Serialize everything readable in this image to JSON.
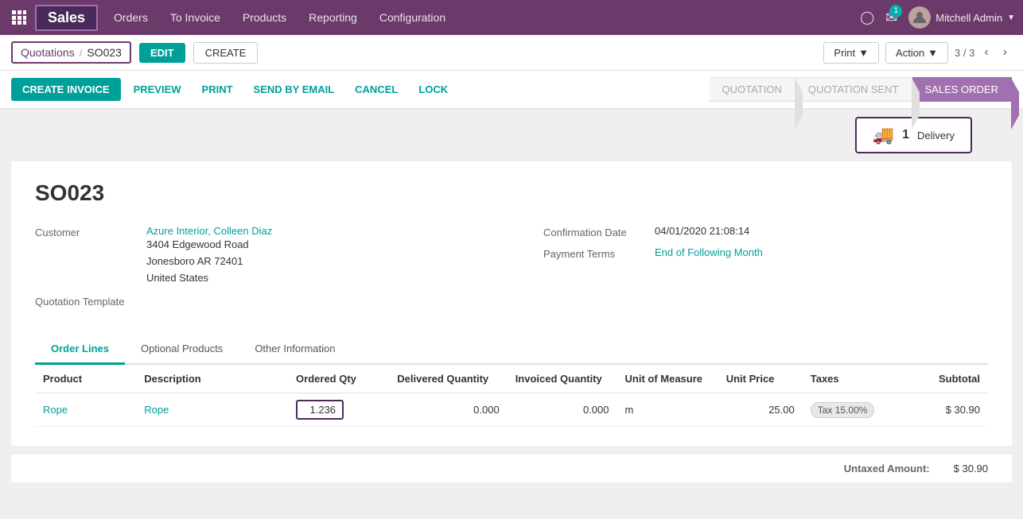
{
  "app": {
    "brand": "Sales"
  },
  "topnav": {
    "links": [
      "Orders",
      "To Invoice",
      "Products",
      "Reporting",
      "Configuration"
    ],
    "chat_badge": "1",
    "user": "Mitchell Admin"
  },
  "breadcrumb": {
    "parent": "Quotations",
    "current": "SO023"
  },
  "actions": {
    "edit_label": "EDIT",
    "create_label": "CREATE",
    "print_label": "Print",
    "action_label": "Action",
    "pagination": "3 / 3"
  },
  "toolbar": {
    "create_invoice_label": "CREATE INVOICE",
    "preview_label": "PREVIEW",
    "print_label": "PRINT",
    "send_email_label": "SEND BY EMAIL",
    "cancel_label": "CANCEL",
    "lock_label": "LOCK"
  },
  "status_bar": {
    "items": [
      "QUOTATION",
      "QUOTATION SENT",
      "SALES ORDER"
    ]
  },
  "delivery": {
    "count": "1",
    "label": "Delivery"
  },
  "form": {
    "so_number": "SO023",
    "customer_label": "Customer",
    "customer_name": "Azure Interior, Colleen Diaz",
    "customer_address": "3404 Edgewood Road\nJonesboro AR 72401\nUnited States",
    "quotation_template_label": "Quotation Template",
    "confirmation_date_label": "Confirmation Date",
    "confirmation_date": "04/01/2020 21:08:14",
    "payment_terms_label": "Payment Terms",
    "payment_terms": "End of Following Month"
  },
  "tabs": {
    "items": [
      "Order Lines",
      "Optional Products",
      "Other Information"
    ]
  },
  "table": {
    "headers": [
      "Product",
      "Description",
      "Ordered Qty",
      "Delivered Quantity",
      "Invoiced Quantity",
      "Unit of Measure",
      "Unit Price",
      "Taxes",
      "Subtotal"
    ],
    "rows": [
      {
        "product": "Rope",
        "description": "Rope",
        "ordered_qty": "1.236",
        "delivered_qty": "0.000",
        "invoiced_qty": "0.000",
        "uom": "m",
        "unit_price": "25.00",
        "taxes": "Tax 15.00%",
        "subtotal": "$ 30.90"
      }
    ]
  },
  "summary": {
    "untaxed_label": "Untaxed Amount:",
    "untaxed_value": "$ 30.90"
  }
}
